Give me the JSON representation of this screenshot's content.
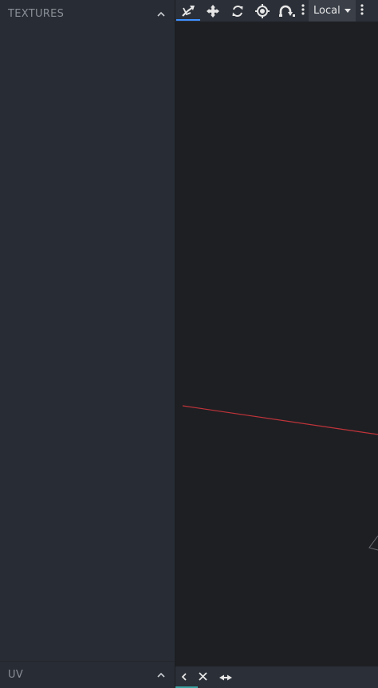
{
  "left_panel": {
    "textures_header": "TEXTURES",
    "uv_header": "UV"
  },
  "toolbar": {
    "tools": [
      {
        "name": "pivot-tool-icon"
      },
      {
        "name": "move-tool-icon"
      },
      {
        "name": "rotate-tool-icon"
      },
      {
        "name": "pivot-point-icon"
      },
      {
        "name": "vertex-snap-icon"
      }
    ],
    "space_select": "Local"
  },
  "bottom_bar": {
    "icons": [
      "chevron-left-icon",
      "close-icon",
      "diamond-arrows-icon"
    ]
  },
  "colors": {
    "panel_bg": "#282c34",
    "viewport_bg": "#1e1f23",
    "toolbar_bg": "#2b2f37",
    "accent": "#3e90ff",
    "axis_x": "#c0343a"
  }
}
